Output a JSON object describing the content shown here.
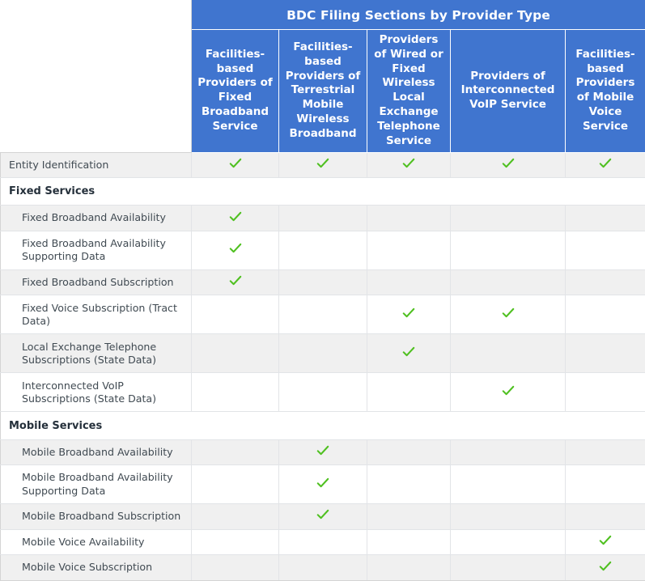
{
  "table": {
    "title": "BDC Filing Sections by Provider Type",
    "corner_label": "",
    "accent_color": "#4075cf",
    "check_color": "#4fc020",
    "stripe_color": "#f0f0f0",
    "border_color": "#d4d4d4",
    "columns": [
      "Facilities-based Providers of Fixed Broadband Service",
      "Facilities-based Providers of Terrestrial Mobile Wireless Broadband",
      "Providers of Wired or Fixed Wireless Local Exchange Telephone Service",
      "Providers of Interconnected VoIP Service",
      "Facilities-based Providers of Mobile Voice Service"
    ],
    "rows": [
      {
        "kind": "data",
        "label": "Entity Identification",
        "checks": [
          true,
          true,
          true,
          true,
          true
        ]
      },
      {
        "kind": "section",
        "label": "Fixed Services",
        "checks": [
          false,
          false,
          false,
          false,
          false
        ]
      },
      {
        "kind": "data",
        "label": "Fixed Broadband Availability",
        "checks": [
          true,
          false,
          false,
          false,
          false
        ]
      },
      {
        "kind": "data",
        "label": "Fixed Broadband Availability Supporting Data",
        "checks": [
          true,
          false,
          false,
          false,
          false
        ]
      },
      {
        "kind": "data",
        "label": "Fixed Broadband Subscription",
        "checks": [
          true,
          false,
          false,
          false,
          false
        ]
      },
      {
        "kind": "data",
        "label": "Fixed Voice Subscription (Tract Data)",
        "checks": [
          false,
          false,
          true,
          true,
          false
        ]
      },
      {
        "kind": "data",
        "label": "Local Exchange Telephone Subscriptions (State Data)",
        "checks": [
          false,
          false,
          true,
          false,
          false
        ]
      },
      {
        "kind": "data",
        "label": "Interconnected VoIP Subscriptions (State Data)",
        "checks": [
          false,
          false,
          false,
          true,
          false
        ]
      },
      {
        "kind": "section",
        "label": "Mobile Services",
        "checks": [
          false,
          false,
          false,
          false,
          false
        ]
      },
      {
        "kind": "data",
        "label": "Mobile Broadband Availability",
        "checks": [
          false,
          true,
          false,
          false,
          false
        ]
      },
      {
        "kind": "data",
        "label": "Mobile Broadband Availability Supporting Data",
        "checks": [
          false,
          true,
          false,
          false,
          false
        ]
      },
      {
        "kind": "data",
        "label": "Mobile Broadband Subscription",
        "checks": [
          false,
          true,
          false,
          false,
          false
        ]
      },
      {
        "kind": "data",
        "label": "Mobile Voice Availability",
        "checks": [
          false,
          false,
          false,
          false,
          true
        ]
      },
      {
        "kind": "data",
        "label": "Mobile Voice Subscription",
        "checks": [
          false,
          false,
          false,
          false,
          true
        ]
      }
    ]
  }
}
